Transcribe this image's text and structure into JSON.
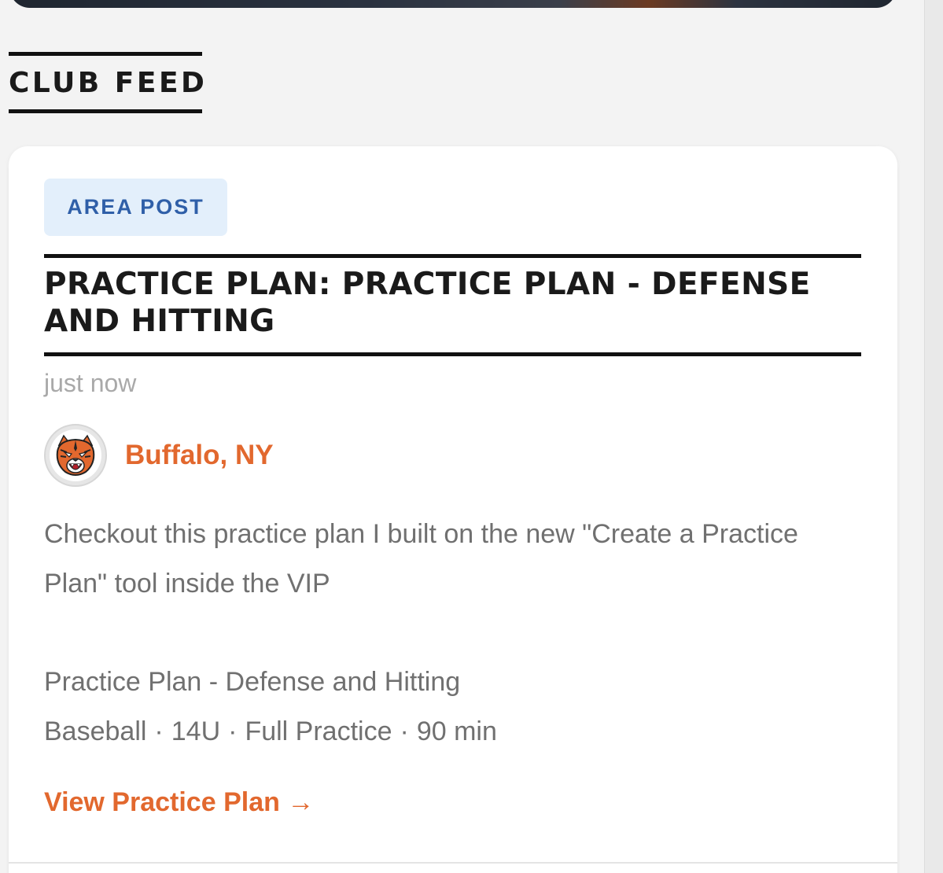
{
  "section": {
    "title": "CLUB FEED"
  },
  "post": {
    "badge": "AREA POST",
    "title": "PRACTICE PLAN: PRACTICE PLAN - DEFENSE AND HITTING",
    "timestamp": "just now",
    "author": {
      "name": "Buffalo, NY",
      "avatar_icon": "tiger-mascot-icon"
    },
    "body": "Checkout this practice plan I built on the new \"Create a Practice Plan\" tool inside the VIP",
    "plan": {
      "name": "Practice Plan - Defense and Hitting",
      "sport": "Baseball",
      "age_group": "14U",
      "type": "Full Practice",
      "duration": "90 min",
      "separator": "·"
    },
    "link_label": "View Practice Plan →"
  },
  "colors": {
    "accent": "#e2682e",
    "badge_bg": "#e3effb",
    "badge_text": "#2f5fa8",
    "body_text": "#707070",
    "muted_text": "#a9a9a9",
    "page_bg": "#f3f3f3"
  }
}
